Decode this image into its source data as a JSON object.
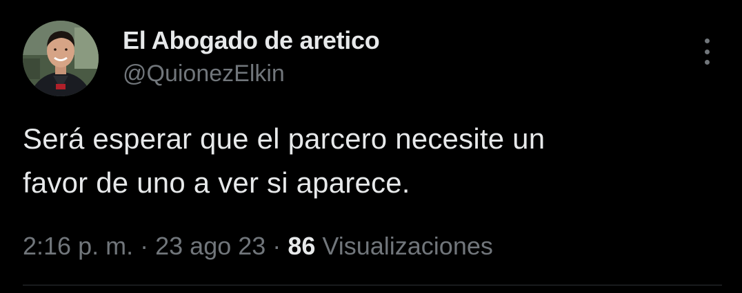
{
  "tweet": {
    "author": {
      "display_name": "El Abogado de aretico",
      "handle": "@QuionezElkin",
      "avatar_icon": "profile-photo"
    },
    "text_line_1": "Será esperar que el parcero necesite un",
    "text_line_2": "favor de uno a ver si aparece.",
    "time": "2:16 p. m.",
    "separator": "·",
    "date": "23 ago 23",
    "views_count": "86",
    "views_label": "Visualizaciones",
    "more_icon": "more-vertical-icon"
  },
  "colors": {
    "background": "#000000",
    "primary_text": "#e7e9ea",
    "secondary_text": "#71767b",
    "divider": "#2f3336"
  }
}
